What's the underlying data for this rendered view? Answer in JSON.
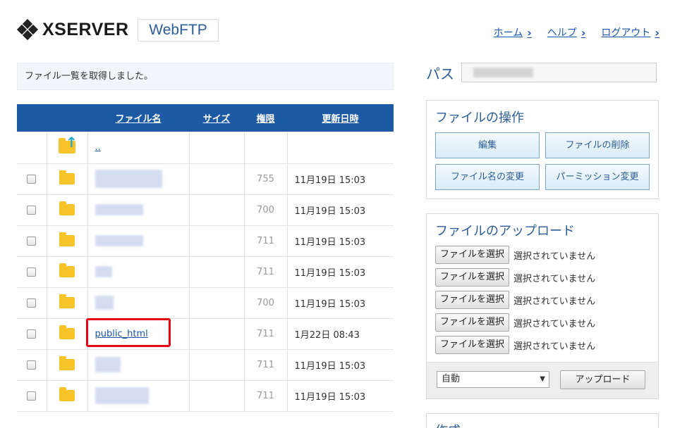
{
  "header": {
    "logo_text": "XSERVER",
    "app_name": "WebFTP",
    "nav": [
      {
        "label": "ホーム"
      },
      {
        "label": "ヘルプ"
      },
      {
        "label": "ログアウト"
      }
    ]
  },
  "message": "ファイル一覧を取得しました。",
  "table": {
    "headers": {
      "name": "ファイル名",
      "size": "サイズ",
      "perm": "権限",
      "date": "更新日時"
    },
    "parent_link": "..",
    "rows": [
      {
        "name": "",
        "perm": "755",
        "date": "11月19日 15:03"
      },
      {
        "name": "",
        "perm": "700",
        "date": "11月19日 15:03"
      },
      {
        "name": "",
        "perm": "711",
        "date": "11月19日 15:03"
      },
      {
        "name": "",
        "perm": "711",
        "date": "11月19日 15:03"
      },
      {
        "name": "",
        "perm": "700",
        "date": "11月19日 15:03"
      },
      {
        "name": "public_html",
        "perm": "711",
        "date": "1月22日 08:43"
      },
      {
        "name": "",
        "perm": "711",
        "date": "11月19日 15:03"
      },
      {
        "name": "",
        "perm": "711",
        "date": "11月19日 15:03"
      }
    ]
  },
  "path": {
    "label": "パス",
    "value": ""
  },
  "operations": {
    "title": "ファイルの操作",
    "edit": "編集",
    "delete": "ファイルの削除",
    "rename": "ファイル名の変更",
    "permission": "パーミッション変更"
  },
  "upload": {
    "title": "ファイルのアップロード",
    "choose_label": "ファイルを選択",
    "no_file_label": "選択されていません",
    "encoding": "自動",
    "upload_button": "アップロード"
  },
  "create": {
    "title": "作成"
  },
  "colors": {
    "accent": "#1c5aa6",
    "highlight": "#e60012",
    "folder": "#f7c32b"
  }
}
